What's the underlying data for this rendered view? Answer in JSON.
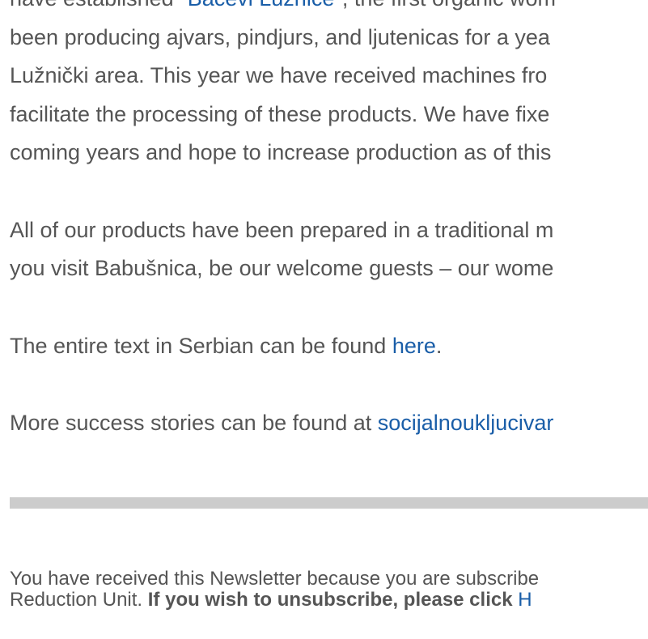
{
  "article": {
    "p1": {
      "line0_pre": "have established \"",
      "line0_link": "Bačevi Lužnice",
      "line0_post": "\", the first organic wom",
      "line1": "been producing ajvars, pindjurs, and ljutenicas for a yea",
      "line2": "Lužnički area. This year we have received machines fro",
      "line3": "facilitate the processing of these products. We have fixe",
      "line4": "coming years and hope to increase production as of this"
    },
    "p2": {
      "line0": "All of our products have been prepared in a traditional m",
      "line1": "you visit Babušnica, be our welcome guests – our wome"
    },
    "p3": {
      "pre": "The entire text in Serbian can be found ",
      "link": "here",
      "post": "."
    },
    "p4": {
      "pre": "More success stories can be found at ",
      "link": "socijalnoukljucivar"
    }
  },
  "footer": {
    "line0": "You have received this Newsletter because you are subscribe",
    "line1_pre": "Reduction Unit. ",
    "line1_bold": "If you wish to unsubscribe, please click ",
    "line1_link": "H"
  },
  "colors": {
    "text": "#555555",
    "link": "#1a5ea8",
    "divider": "#cccccc"
  }
}
